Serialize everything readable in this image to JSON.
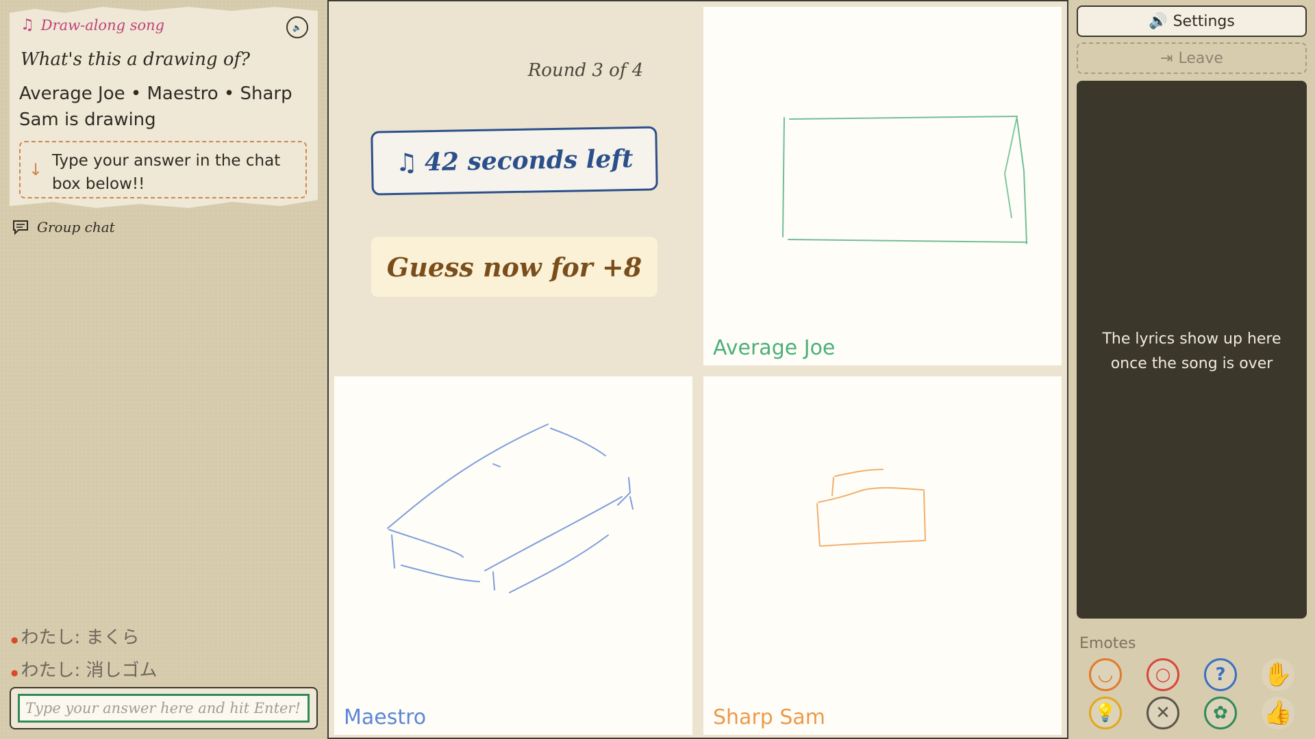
{
  "prompt": {
    "song_title": "Draw-along song",
    "question": "What's this a drawing of?",
    "drawers": "Average Joe • Maestro • Sharp Sam is drawing",
    "hint": "Type your answer in the chat box below!!"
  },
  "chat": {
    "label": "Group chat",
    "messages": [
      {
        "text": "わたし: まくら"
      },
      {
        "text": "わたし: 消しゴム"
      }
    ],
    "placeholder": "Type your answer here and hit Enter!"
  },
  "game": {
    "round": "Round 3 of 4",
    "timer": "42 seconds left",
    "guess": "Guess now for +8"
  },
  "players": [
    {
      "name": "Average Joe",
      "color": "#4caf7a"
    },
    {
      "name": "Maestro",
      "color": "#5b86d6"
    },
    {
      "name": "Sharp Sam",
      "color": "#ec9a4a"
    }
  ],
  "sidebar": {
    "settings_label": "Settings",
    "leave_label": "Leave",
    "lyrics_placeholder": "The lyrics show up here once the song is over",
    "emotes_label": "Emotes",
    "emotes": [
      {
        "icon": "laughing-face-icon",
        "color": "#e07b2a"
      },
      {
        "icon": "shocked-face-icon",
        "color": "#d9453a"
      },
      {
        "icon": "question-mark-icon",
        "color": "#3a6fc4"
      },
      {
        "icon": "raised-hand-icon",
        "color": "#c0427a"
      },
      {
        "icon": "light-bulb-icon",
        "color": "#e0a820"
      },
      {
        "icon": "dizzy-face-icon",
        "color": "#5a554a"
      },
      {
        "icon": "flower-icon",
        "color": "#2f8a5a"
      },
      {
        "icon": "thumbs-up-icon",
        "color": "#2f8a5a"
      }
    ]
  }
}
